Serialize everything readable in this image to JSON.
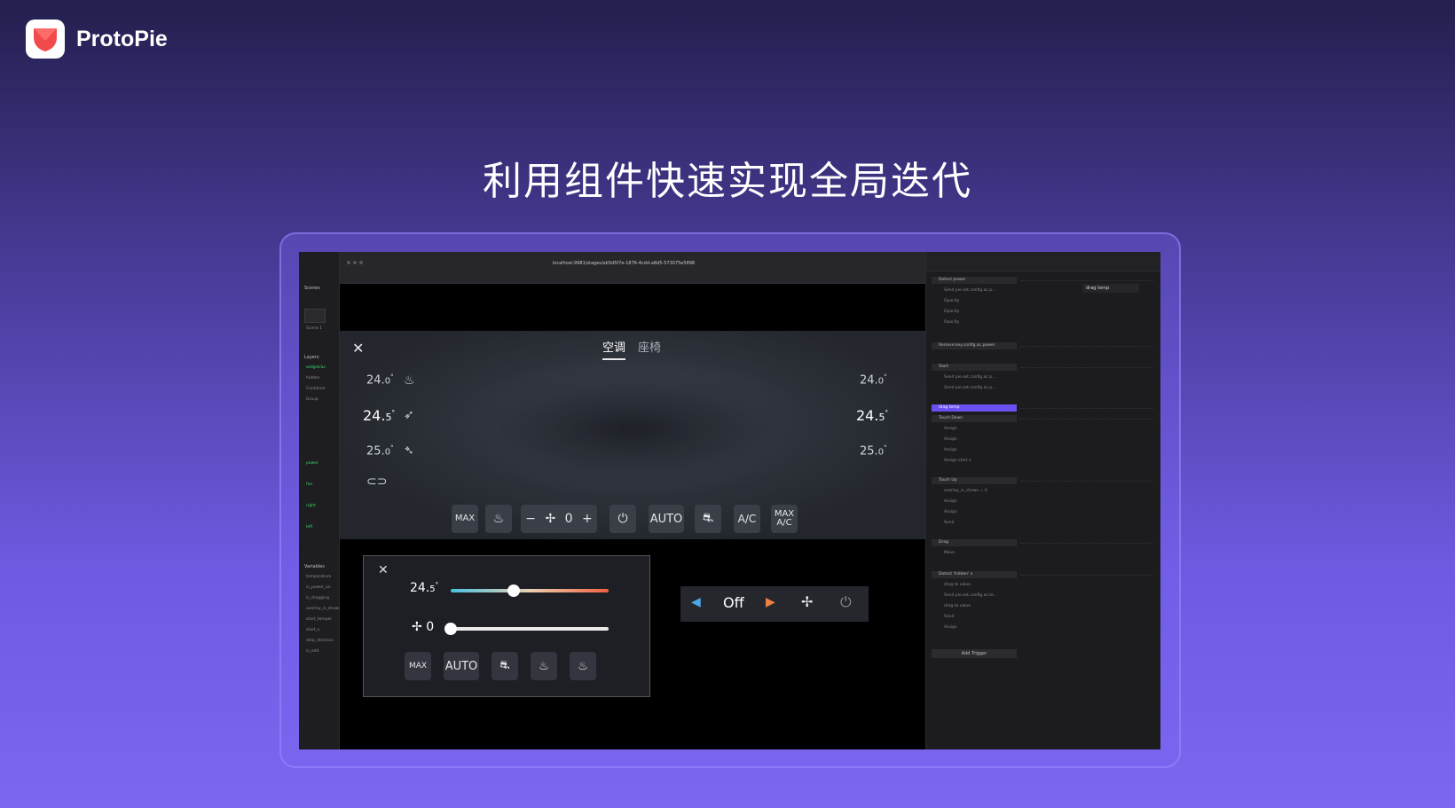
{
  "brand": {
    "name": "ProtoPie",
    "logo_icon": "protopie-logo-icon"
  },
  "headline": "利用组件快速实现全局迭代",
  "browser": {
    "url": "localhost:9981/stages/eb5d5f7e-1876-4cdd-a8d5-573075e5898"
  },
  "left_sidebar": {
    "scenes_label": "Scenes",
    "scene_name": "Scene 1",
    "layers_label": "Layers",
    "layers": [
      "widget/ac",
      "hidden",
      "Container",
      "Group",
      "power",
      "fan",
      "right",
      "left"
    ],
    "variables_label": "Variables",
    "variables": [
      "temperature",
      "is_power_on",
      "is_dragging",
      "overlay_is_shown",
      "start_temper",
      "start_x",
      "step_distance",
      "is_edit"
    ]
  },
  "ac_panel": {
    "tabs": [
      {
        "label": "空调"
      },
      {
        "label": "座椅"
      }
    ],
    "left_temps": [
      {
        "whole": "24.",
        "decimal": "0",
        "unit": "°"
      },
      {
        "whole": "24.",
        "decimal": "5",
        "unit": "°"
      },
      {
        "whole": "25.",
        "decimal": "0",
        "unit": "°"
      }
    ],
    "right_temps": [
      {
        "whole": "24.",
        "decimal": "0",
        "unit": "°"
      },
      {
        "whole": "24.",
        "decimal": "5",
        "unit": "°"
      },
      {
        "whole": "25.",
        "decimal": "0",
        "unit": "°"
      }
    ],
    "controls": {
      "max": "MAX",
      "fan_minus": "−",
      "fan_speed": "0",
      "fan_plus": "+",
      "auto": "AUTO",
      "ac": "A/C",
      "max_ac_top": "MAX",
      "max_ac_bottom": "A/C"
    }
  },
  "slider_popup": {
    "temperature": {
      "whole": "24.",
      "decimal": "5",
      "unit": "°"
    },
    "temperature_level": 0.4,
    "fan_speed": "0",
    "fan_level": 0.0,
    "buttons": {
      "max": "MAX",
      "auto": "AUTO"
    }
  },
  "fan_bar": {
    "state": "Off"
  },
  "triggers": {
    "items": [
      "Detect power",
      "Send pie.set.config.ac.p...",
      "Opacity",
      "Opacity",
      "Opacity",
      "Receive key.config.ac.power",
      "Start",
      "Send pie.set.config.ac.p...",
      "Send pie.set.config.ac.p...",
      "drag temp",
      "Touch Down",
      "Assign",
      "Assign",
      "Assign",
      "Assign start x",
      "Touch Up",
      "overlay_is_shown = 0",
      "Assign",
      "Assign",
      "Send",
      "Drag",
      "Move",
      "Detect 'hidden' x",
      "drag to value",
      "Send pie.set.config.ac.te...",
      "drag to value",
      "Send",
      "Assign"
    ],
    "add_trigger": "Add Trigger",
    "property_label": "drag temp"
  },
  "colors": {
    "accent": "#6b4ff0",
    "slider_cool": "#4ac0e0",
    "slider_warm": "#f06040"
  }
}
